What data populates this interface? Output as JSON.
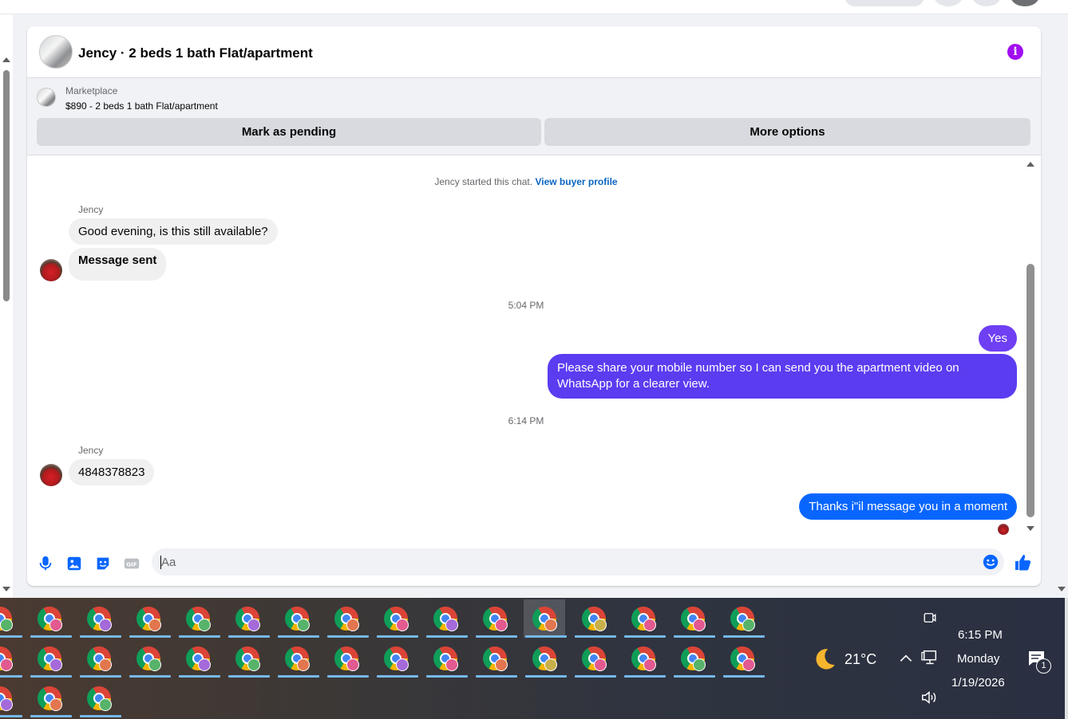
{
  "chat": {
    "title": "Jency · 2 beds 1 bath Flat/apartment",
    "marketplace_label": "Marketplace",
    "listing": "$890 - 2 beds 1 bath Flat/apartment",
    "mark_pending_label": "Mark as pending",
    "more_options_label": "More options",
    "started_text": "Jency started this chat.",
    "view_profile_label": "View buyer profile",
    "messages": [
      {
        "from": "Jency",
        "sender_label": "Jency",
        "text": "Good evening, is this still available?"
      },
      {
        "from": "Jency",
        "text": "Message sent"
      },
      {
        "timestamp": "5:04 PM"
      },
      {
        "from": "me",
        "text": "Yes",
        "color": "#6e3ff3"
      },
      {
        "from": "me",
        "text": "Please share your mobile number so I can send you the apartment video on WhatsApp for a clearer view.",
        "color": "#5b3cf0"
      },
      {
        "timestamp": "6:14 PM"
      },
      {
        "from": "Jency",
        "sender_label": "Jency",
        "text": "4848378823"
      },
      {
        "from": "me",
        "text": "Thanks i\"il message you in a moment",
        "color": "#0866ff"
      }
    ],
    "composer_placeholder": "Aa"
  },
  "taskbar": {
    "weather_temp": "21°C",
    "time": "6:15 PM",
    "day": "Monday",
    "date": "1/19/2026",
    "notification_count": "1"
  },
  "colors": {
    "accent_purple": "#a10ff0",
    "link_blue": "#0a66c2",
    "outgoing_blue": "#0866ff"
  }
}
